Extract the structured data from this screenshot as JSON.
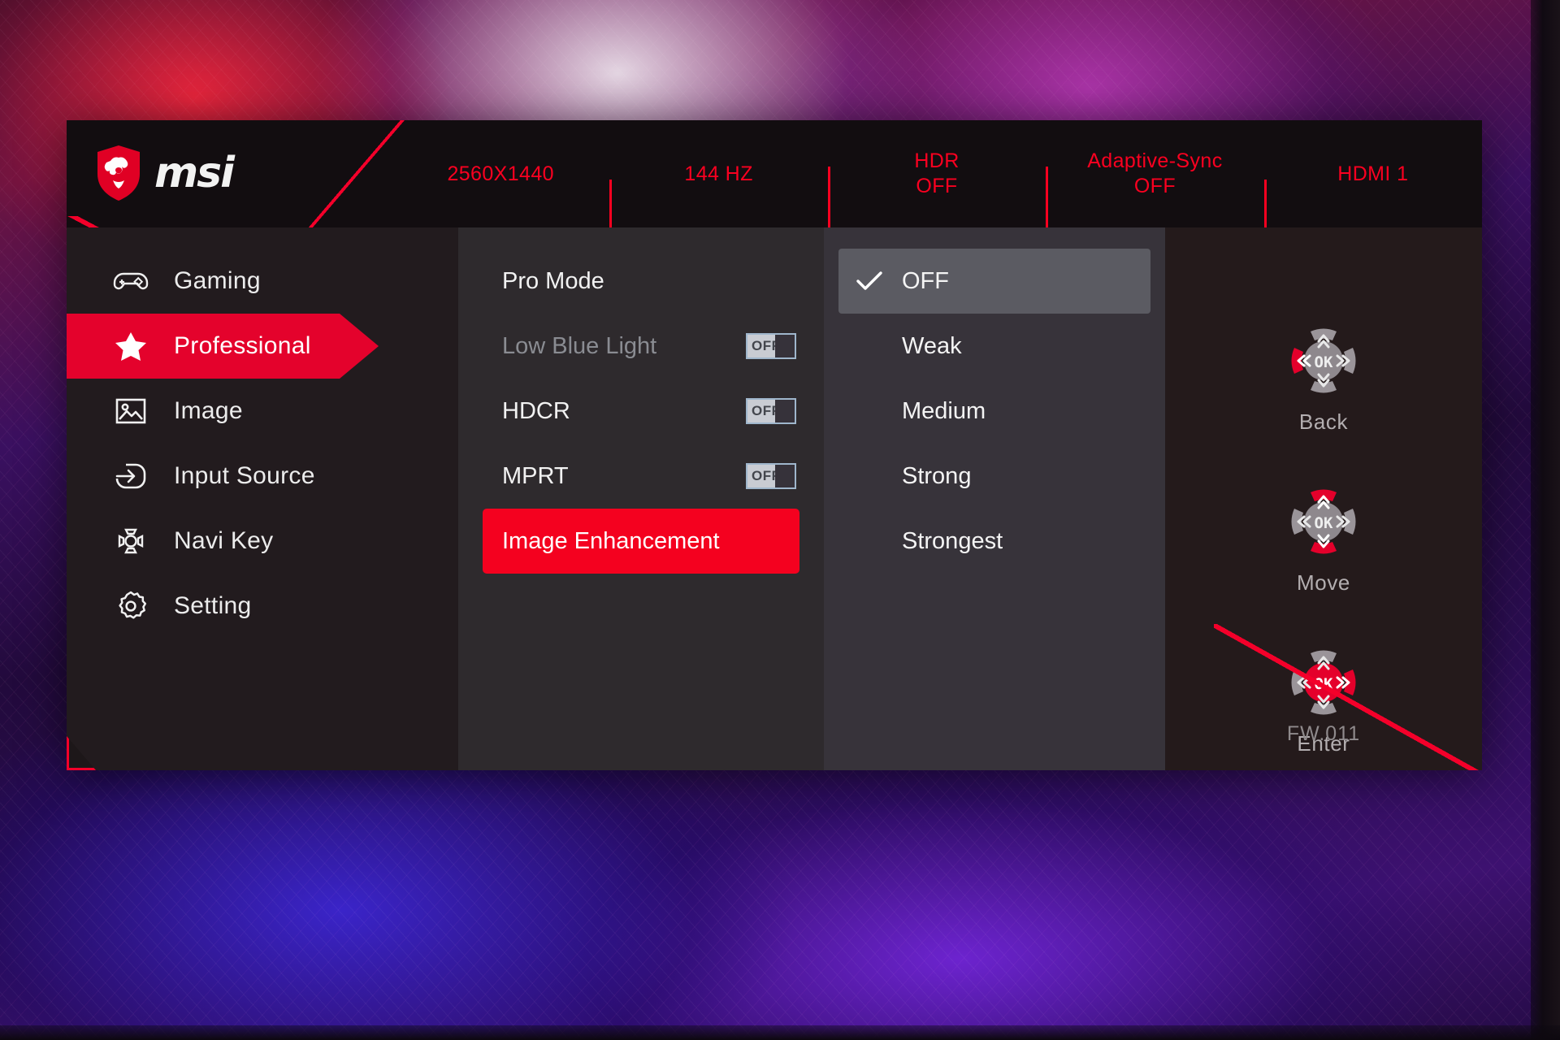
{
  "brand": {
    "name": "msi",
    "logo_icon": "msi-dragon-shield-icon"
  },
  "header": {
    "stats": [
      {
        "label": "2560X1440",
        "sub": ""
      },
      {
        "label": "144 HZ",
        "sub": ""
      },
      {
        "label": "HDR",
        "sub": "OFF"
      },
      {
        "label": "Adaptive-Sync",
        "sub": "OFF"
      },
      {
        "label": "HDMI 1",
        "sub": ""
      }
    ]
  },
  "menu": {
    "items": [
      {
        "label": "Gaming",
        "icon": "gamepad-icon",
        "selected": false
      },
      {
        "label": "Professional",
        "icon": "star-icon",
        "selected": true
      },
      {
        "label": "Image",
        "icon": "picture-icon",
        "selected": false
      },
      {
        "label": "Input Source",
        "icon": "input-arrow-icon",
        "selected": false
      },
      {
        "label": "Navi Key",
        "icon": "navi-key-icon",
        "selected": false
      },
      {
        "label": "Setting",
        "icon": "gear-icon",
        "selected": false
      }
    ]
  },
  "submenu": {
    "rows": [
      {
        "label": "Pro Mode",
        "toggle": null,
        "state": "normal"
      },
      {
        "label": "Low Blue Light",
        "toggle": "OFF",
        "state": "dim"
      },
      {
        "label": "HDCR",
        "toggle": "OFF",
        "state": "normal"
      },
      {
        "label": "MPRT",
        "toggle": "OFF",
        "state": "normal"
      },
      {
        "label": "Image Enhancement",
        "toggle": null,
        "state": "active"
      }
    ]
  },
  "options": {
    "items": [
      {
        "label": "OFF",
        "checked": true
      },
      {
        "label": "Weak",
        "checked": false
      },
      {
        "label": "Medium",
        "checked": false
      },
      {
        "label": "Strong",
        "checked": false
      },
      {
        "label": "Strongest",
        "checked": false
      }
    ]
  },
  "nav": {
    "hints": [
      {
        "label": "Back",
        "icon": "joystick-left-icon",
        "highlight": "left"
      },
      {
        "label": "Move",
        "icon": "joystick-updown-icon",
        "highlight": "updown"
      },
      {
        "label": "Enter",
        "icon": "joystick-ok-right-icon",
        "highlight": "ok-right"
      }
    ],
    "firmware": "FW.011"
  },
  "colors": {
    "accent_red": "#f4002a",
    "select_red": "#e4022c",
    "panel_dark": "#221b1e",
    "panel_mid": "#2e2a2d",
    "panel_light": "#37333a",
    "text": "#f0f0f0",
    "text_dim": "#8a8c92"
  }
}
